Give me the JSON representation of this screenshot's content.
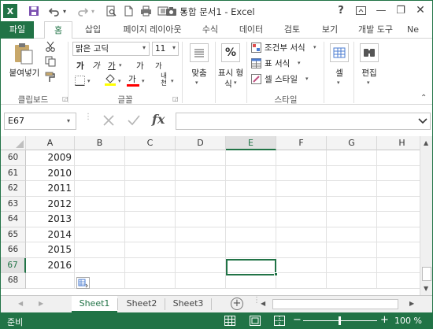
{
  "window": {
    "title": "통합 문서1 - Excel",
    "help": "?",
    "minimize": "—",
    "restore": "❐",
    "close": "✕"
  },
  "quick_access": {
    "excel_icon": "X",
    "save": "💾",
    "undo": "↶",
    "redo": "↷",
    "print_preview": "🗋",
    "print": "🖶",
    "camera": "📷"
  },
  "tabs": [
    "파일",
    "홈",
    "삽입",
    "페이지 레이아웃",
    "수식",
    "데이터",
    "검토",
    "보기",
    "개발 도구",
    "Ne"
  ],
  "ribbon": {
    "clipboard": {
      "paste_label": "붙여넣기",
      "group_label": "클립보드"
    },
    "font": {
      "font_name": "맑은 고딕",
      "font_size": "11",
      "bold": "가",
      "italic": "가",
      "underline": "가",
      "grow": "가",
      "shrink": "가",
      "fill_color": "#ffff00",
      "font_color_letter": "가",
      "font_color": "#ff0000",
      "phonetic": "내천",
      "group_label": "글꼴"
    },
    "alignment": {
      "label": "맞춤"
    },
    "number": {
      "label": "표시 형\n식",
      "line1": "표시 형",
      "line2": "식"
    },
    "styles": {
      "conditional": "조건부 서식",
      "table": "표 서식",
      "cell_style": "셀 스타일",
      "group_label": "스타일"
    },
    "cells": {
      "label": "셀"
    },
    "editing": {
      "label": "편집"
    }
  },
  "formula_bar": {
    "name_box": "E67",
    "fx": "fx",
    "value": ""
  },
  "columns": [
    "A",
    "B",
    "C",
    "D",
    "E",
    "F",
    "G",
    "H"
  ],
  "selected_column": "E",
  "rows": [
    {
      "num": "60",
      "a": "2009"
    },
    {
      "num": "61",
      "a": "2010"
    },
    {
      "num": "62",
      "a": "2011"
    },
    {
      "num": "63",
      "a": "2012"
    },
    {
      "num": "64",
      "a": "2013"
    },
    {
      "num": "65",
      "a": "2014"
    },
    {
      "num": "66",
      "a": "2015"
    },
    {
      "num": "67",
      "a": "2016"
    },
    {
      "num": "68",
      "a": ""
    }
  ],
  "selected_row": "67",
  "sheets": [
    "Sheet1",
    "Sheet2",
    "Sheet3"
  ],
  "active_sheet": "Sheet1",
  "status": {
    "mode": "준비",
    "zoom": "100 %",
    "zoom_minus": "−",
    "zoom_plus": "+"
  },
  "colors": {
    "accent": "#217346"
  }
}
